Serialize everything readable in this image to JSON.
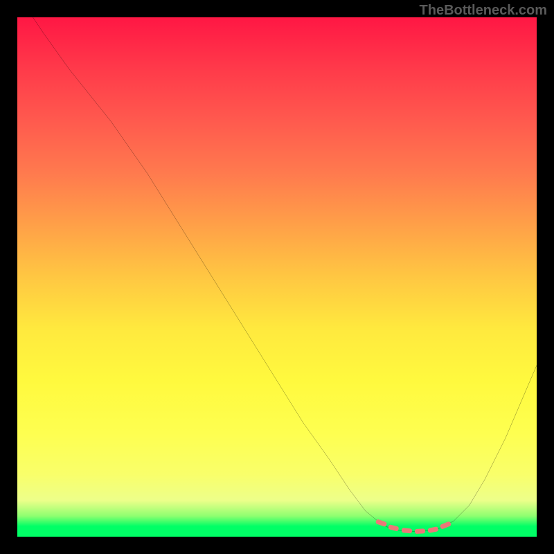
{
  "watermark": "TheBottleneck.com",
  "chart_data": {
    "type": "line",
    "title": "",
    "xlabel": "",
    "ylabel": "",
    "xlim": [
      0,
      100
    ],
    "ylim": [
      0,
      100
    ],
    "gradient_stops": [
      {
        "pos": 0,
        "color": "#ff1744"
      },
      {
        "pos": 10,
        "color": "#ff3a4a"
      },
      {
        "pos": 20,
        "color": "#ff5a4e"
      },
      {
        "pos": 30,
        "color": "#ff7a4e"
      },
      {
        "pos": 40,
        "color": "#ffa048"
      },
      {
        "pos": 50,
        "color": "#ffc742"
      },
      {
        "pos": 60,
        "color": "#ffe93e"
      },
      {
        "pos": 70,
        "color": "#fff93e"
      },
      {
        "pos": 80,
        "color": "#feff50"
      },
      {
        "pos": 88,
        "color": "#f9ff6a"
      },
      {
        "pos": 93,
        "color": "#edff8a"
      },
      {
        "pos": 96,
        "color": "#90ff70"
      },
      {
        "pos": 98,
        "color": "#00ff66"
      },
      {
        "pos": 100,
        "color": "#00ff66"
      }
    ],
    "curve_points": [
      {
        "x": 3,
        "y": 100
      },
      {
        "x": 5,
        "y": 97
      },
      {
        "x": 10,
        "y": 90
      },
      {
        "x": 14,
        "y": 85
      },
      {
        "x": 18,
        "y": 80
      },
      {
        "x": 25,
        "y": 70
      },
      {
        "x": 30,
        "y": 62
      },
      {
        "x": 35,
        "y": 54
      },
      {
        "x": 40,
        "y": 46
      },
      {
        "x": 45,
        "y": 38
      },
      {
        "x": 50,
        "y": 30
      },
      {
        "x": 55,
        "y": 22
      },
      {
        "x": 60,
        "y": 15
      },
      {
        "x": 64,
        "y": 9
      },
      {
        "x": 67,
        "y": 5
      },
      {
        "x": 70,
        "y": 2.5
      },
      {
        "x": 72,
        "y": 1.5
      },
      {
        "x": 75,
        "y": 1
      },
      {
        "x": 78,
        "y": 1
      },
      {
        "x": 81,
        "y": 1.5
      },
      {
        "x": 84,
        "y": 3
      },
      {
        "x": 87,
        "y": 6
      },
      {
        "x": 90,
        "y": 11
      },
      {
        "x": 94,
        "y": 19
      },
      {
        "x": 97,
        "y": 26
      },
      {
        "x": 100,
        "y": 33
      }
    ],
    "highlight_segments": [
      {
        "x1": 69,
        "y1": 3.0,
        "x2": 71,
        "y2": 2.3
      },
      {
        "x1": 71.5,
        "y1": 2.0,
        "x2": 73.5,
        "y2": 1.5
      },
      {
        "x1": 74,
        "y1": 1.3,
        "x2": 76,
        "y2": 1.1
      },
      {
        "x1": 76.5,
        "y1": 1.0,
        "x2": 78.5,
        "y2": 1.1
      },
      {
        "x1": 79,
        "y1": 1.2,
        "x2": 81,
        "y2": 1.6
      },
      {
        "x1": 81.5,
        "y1": 1.8,
        "x2": 83.5,
        "y2": 2.6
      }
    ],
    "colors": {
      "curve": "#000000",
      "highlight": "#ec7878",
      "background": "#000000"
    }
  }
}
